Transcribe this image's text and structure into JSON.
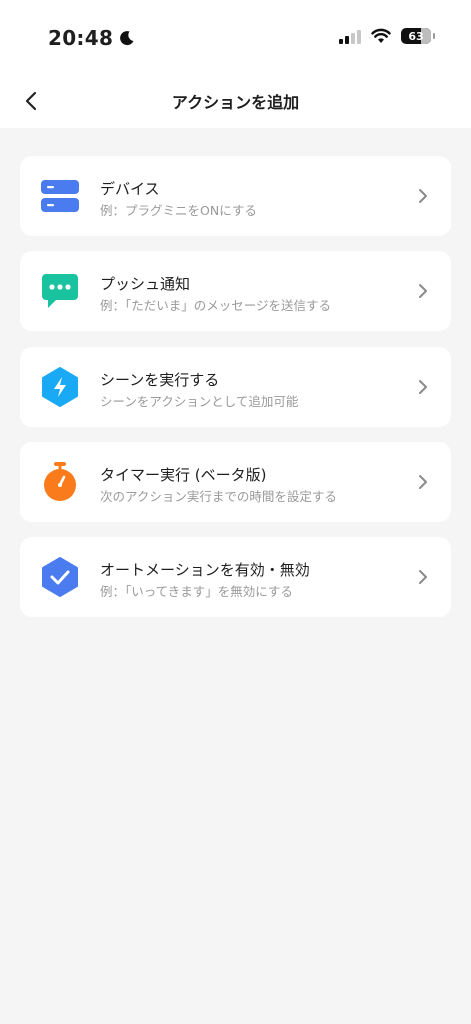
{
  "status_bar": {
    "time": "20:48",
    "battery": "63"
  },
  "header": {
    "title": "アクションを追加"
  },
  "items": [
    {
      "title": "デバイス",
      "subtitle": "例：プラグミニをONにする",
      "icon": "device-icon",
      "color": "#4a7cf0"
    },
    {
      "title": "プッシュ通知",
      "subtitle": "例：「ただいま」のメッセージを送信する",
      "icon": "message-icon",
      "color": "#19c3a0"
    },
    {
      "title": "シーンを実行する",
      "subtitle": "シーンをアクションとして追加可能",
      "icon": "lightning-icon",
      "color": "#1aa9f5"
    },
    {
      "title": "タイマー実行 (ベータ版)",
      "subtitle": "次のアクション実行までの時間を設定する",
      "icon": "stopwatch-icon",
      "color": "#f97b1b"
    },
    {
      "title": "オートメーションを有効・無効",
      "subtitle": "例：「いってきます」を無効にする",
      "icon": "check-icon",
      "color": "#4a7cf0"
    }
  ]
}
